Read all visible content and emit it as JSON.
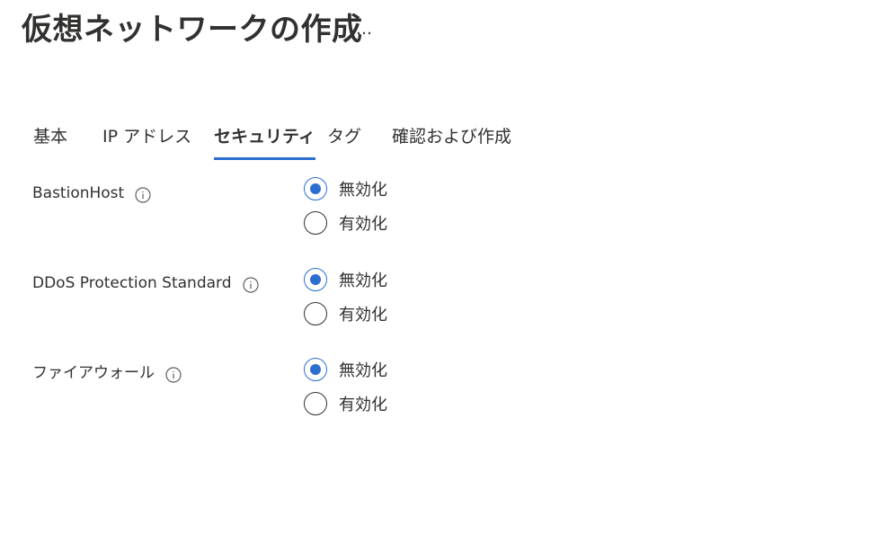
{
  "header": {
    "title": "仮想ネットワークの作成",
    "more_label": "…"
  },
  "tabs": [
    {
      "label": "基本",
      "active": false
    },
    {
      "label": "IP アドレス",
      "active": false
    },
    {
      "label": "セキュリティ",
      "active": true
    },
    {
      "label": "タグ",
      "active": false
    },
    {
      "label": "確認および作成",
      "active": false
    }
  ],
  "settings": [
    {
      "label": "BastionHost",
      "options": [
        {
          "label": "無効化",
          "selected": true
        },
        {
          "label": "有効化",
          "selected": false
        }
      ]
    },
    {
      "label": "DDoS Protection Standard",
      "options": [
        {
          "label": "無効化",
          "selected": true
        },
        {
          "label": "有効化",
          "selected": false
        }
      ]
    },
    {
      "label": "ファイアウォール",
      "options": [
        {
          "label": "無効化",
          "selected": true
        },
        {
          "label": "有効化",
          "selected": false
        }
      ]
    }
  ],
  "colors": {
    "accent": "#2b6fd1",
    "text": "#323130"
  }
}
